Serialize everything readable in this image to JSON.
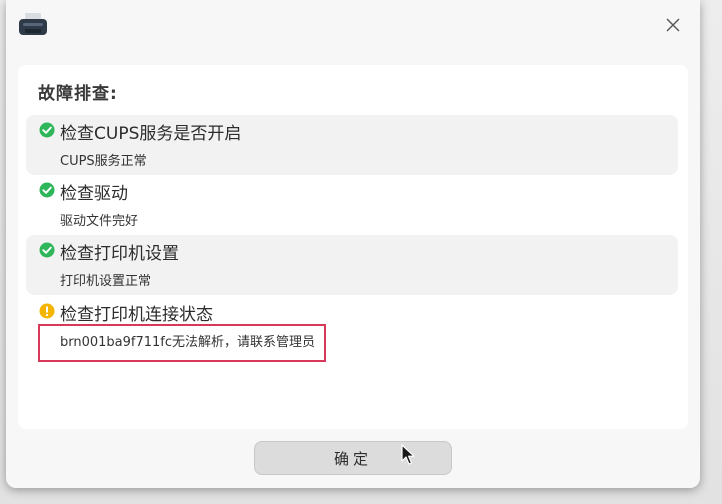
{
  "dialog": {
    "app_icon": "printer-icon",
    "close_icon": "close-icon",
    "heading": "故障排查:",
    "checks": [
      {
        "status": "ok",
        "icon": "check-circle-icon",
        "title": "检查CUPS服务是否开启",
        "detail": "CUPS服务正常"
      },
      {
        "status": "ok",
        "icon": "check-circle-icon",
        "title": "检查驱动",
        "detail": "驱动文件完好"
      },
      {
        "status": "ok",
        "icon": "check-circle-icon",
        "title": "检查打印机设置",
        "detail": "打印机设置正常"
      },
      {
        "status": "warning",
        "icon": "warning-circle-icon",
        "title": "检查打印机连接状态",
        "detail": "brn001ba9f711fc无法解析，请联系管理员"
      }
    ],
    "confirm_label": "确定"
  },
  "colors": {
    "ok": "#2fb65a",
    "warning": "#f5b400",
    "highlight": "#d8385a"
  }
}
